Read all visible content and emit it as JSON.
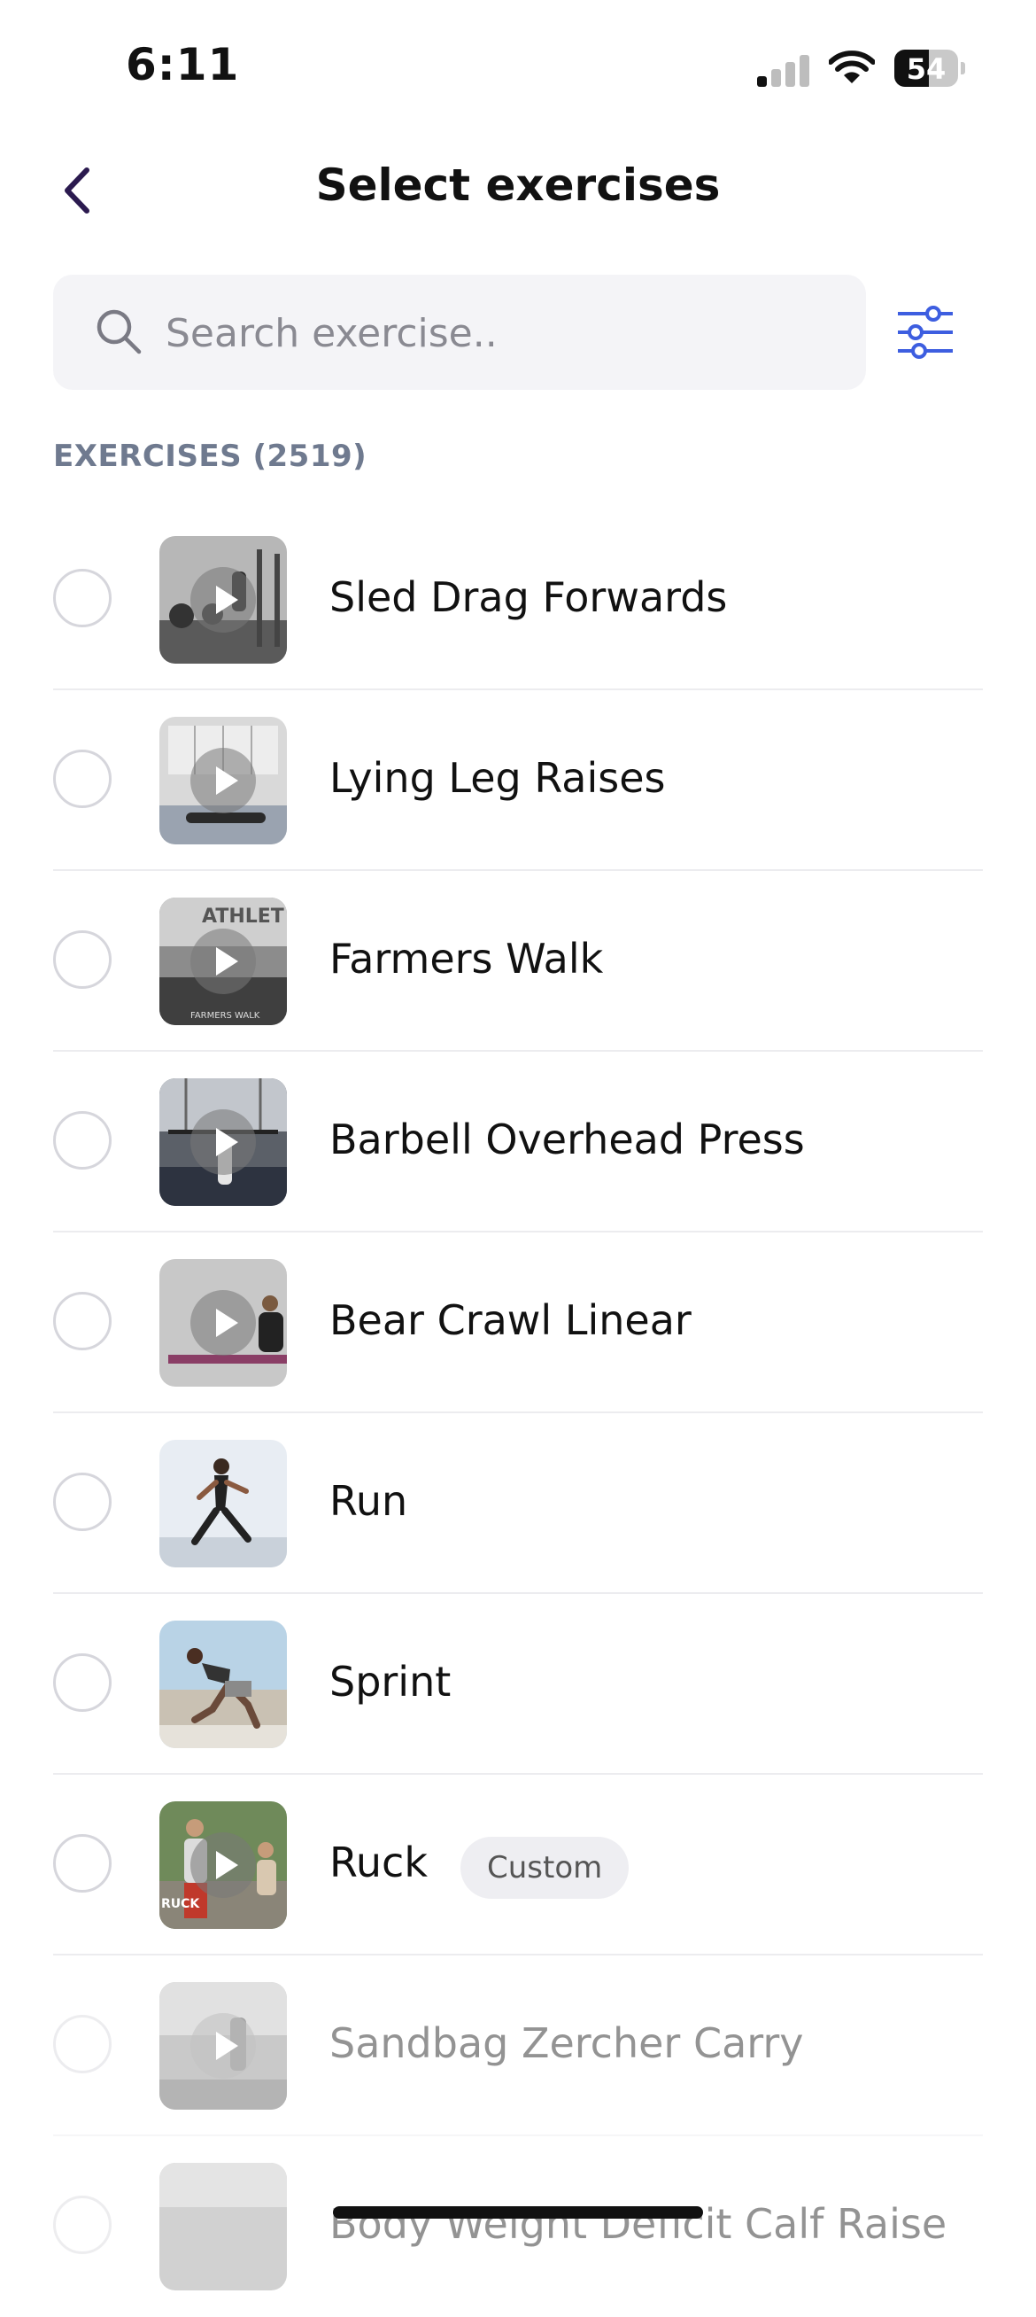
{
  "status_bar": {
    "time": "6:11",
    "battery": "54",
    "battery_level": 0.54
  },
  "header": {
    "title": "Select exercises",
    "back_icon": "chevron-left-icon"
  },
  "search": {
    "placeholder": "Search exercise..",
    "value": ""
  },
  "filter_icon": "sliders-icon",
  "section_label": "EXERCISES (2519)",
  "colors": {
    "accent": "#3d5ee0",
    "back_chevron": "#2b1a4f",
    "badge_bg": "#eeeef2"
  },
  "exercises": [
    {
      "name": "Sled Drag Forwards",
      "video": true
    },
    {
      "name": "Lying Leg Raises",
      "video": true
    },
    {
      "name": "Farmers Walk",
      "video": true,
      "thumb_text": "ATHLETE / FARMERS WALK"
    },
    {
      "name": "Barbell Overhead Press",
      "video": true
    },
    {
      "name": "Bear Crawl Linear",
      "video": true
    },
    {
      "name": "Run",
      "video": false
    },
    {
      "name": "Sprint",
      "video": false
    },
    {
      "name": "Ruck",
      "video": true,
      "badge": "Custom",
      "thumb_text": "RUCK"
    },
    {
      "name": "Sandbag Zercher Carry",
      "video": true
    },
    {
      "name": "Body Weight Deficit Calf Raise",
      "video": true
    }
  ]
}
